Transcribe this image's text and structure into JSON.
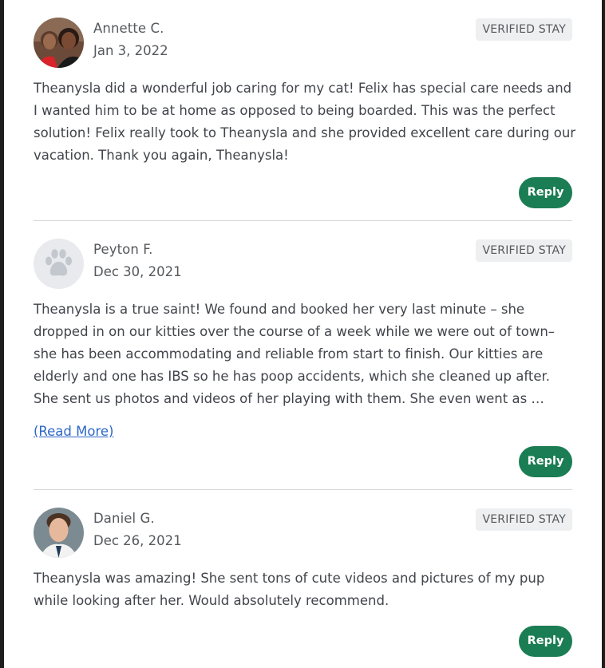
{
  "reviews": [
    {
      "name": "Annette C.",
      "date": "Jan 3, 2022",
      "badge": "VERIFIED STAY",
      "text": "Theanysla did a wonderful job caring for my cat! Felix has special care needs and I wanted him to be at home as opposed to being boarded. This was the perfect solution! Felix really took to Theanysla and she provided excellent care during our vacation. Thank you again, Theanysla!",
      "reply_label": "Reply",
      "avatar_icon": "user-photo"
    },
    {
      "name": "Peyton F.",
      "date": "Dec 30, 2021",
      "badge": "VERIFIED STAY",
      "text": "Theanysla is a true saint! We found and booked her very last minute – she dropped in on our kitties over the course of a week while we were out of town– she has been accommodating and reliable from start to finish. Our kitties are elderly and one has IBS so he has poop accidents, which she cleaned up after. She sent us photos and videos of her playing with them. She even went as …",
      "read_more": "(Read More)",
      "reply_label": "Reply",
      "avatar_icon": "paw-icon"
    },
    {
      "name": "Daniel G.",
      "date": "Dec 26, 2021",
      "badge": "VERIFIED STAY",
      "text": "Theanysla was amazing! She sent tons of cute videos and pictures of my pup while looking after her. Would absolutely recommend.",
      "reply_label": "Reply",
      "avatar_icon": "user-photo"
    }
  ],
  "colors": {
    "reply_button": "#1b7d53",
    "badge_bg": "#eeeff1",
    "link": "#2e67c8",
    "text": "#41444a"
  }
}
